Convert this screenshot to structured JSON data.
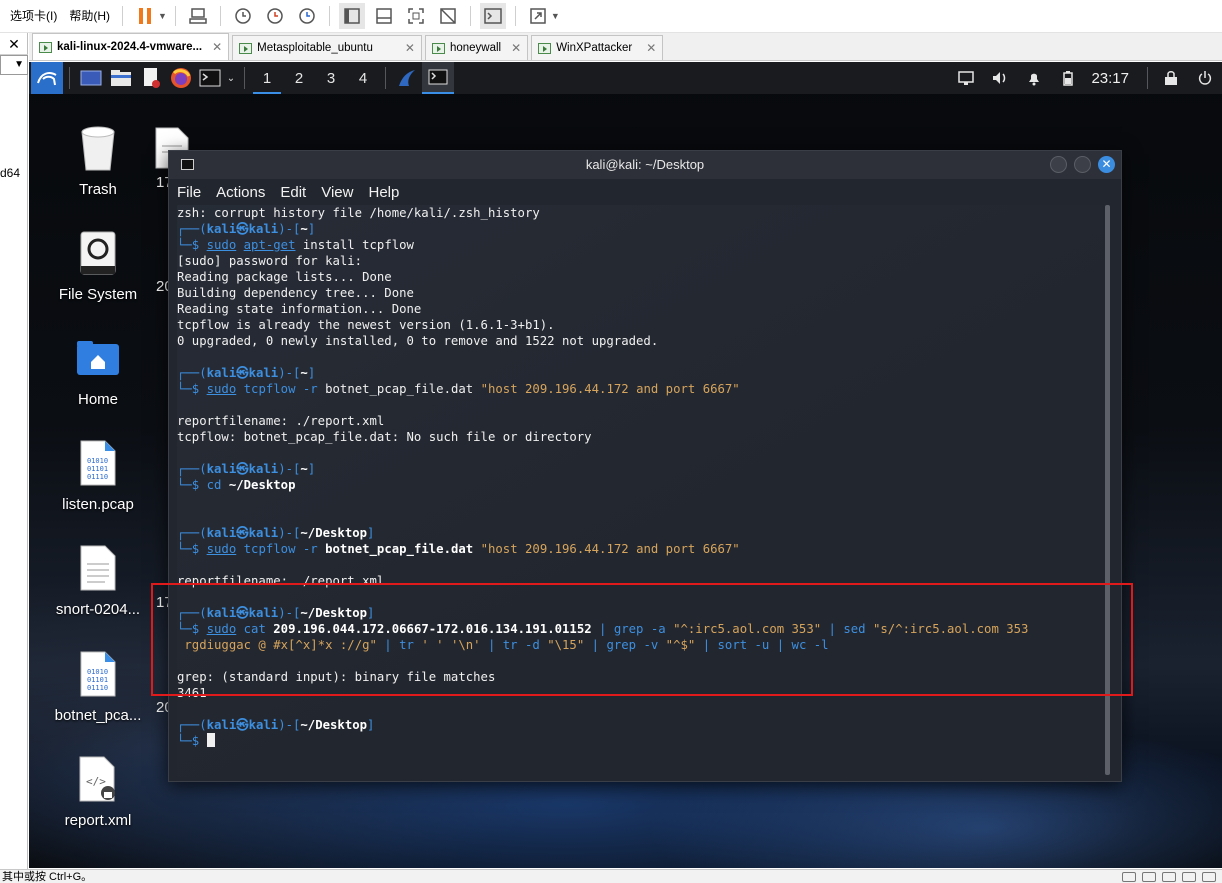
{
  "vmware": {
    "menu": [
      "选项卡(I)",
      "帮助(H)"
    ],
    "tabs": [
      {
        "label": "kali-linux-2024.4-vmware...",
        "close": "✕",
        "active": true
      },
      {
        "label": "Metasploitable_ubuntu",
        "close": "✕",
        "active": false
      },
      {
        "label": "honeywall",
        "close": "✕",
        "active": false
      },
      {
        "label": "WinXPattacker",
        "close": "✕",
        "active": false
      }
    ],
    "left_panel": {
      "close": "✕",
      "combo_arrow": "▼",
      "fragment": "d64"
    },
    "status_text": "其中或按 Ctrl+G。"
  },
  "kali": {
    "workspaces": [
      "1",
      "2",
      "3",
      "4"
    ],
    "active_workspace": "1",
    "clock": "23:17",
    "desktop_icons": [
      {
        "label": "Trash",
        "icon": "trash-icon"
      },
      {
        "label": "File System",
        "icon": "drive-icon"
      },
      {
        "label": "Home",
        "icon": "home-folder-icon"
      },
      {
        "label": "listen.pcap",
        "icon": "binary-file-icon"
      },
      {
        "label": "snort-0204...",
        "icon": "text-file-icon"
      },
      {
        "label": "botnet_pca...",
        "icon": "binary-file-icon"
      },
      {
        "label": "report.xml",
        "icon": "xml-file-icon"
      }
    ],
    "desktop_fragments": [
      "17",
      "20",
      "17",
      "20"
    ],
    "terminal": {
      "title": "kali@kali: ~/Desktop",
      "close_glyph": "✕",
      "menu": [
        "File",
        "Actions",
        "Edit",
        "View",
        "Help"
      ],
      "prompt": {
        "user": "kali",
        "at": "㉿",
        "host": "kali"
      },
      "lines": {
        "l1": "zsh: corrupt history file /home/kali/.zsh_history",
        "p1_dir": "~",
        "c1_sudo": "sudo",
        "c1_cmd": "apt-get",
        "c1_args": " install tcpflow",
        "l2": "[sudo] password for kali:",
        "l3": "Reading package lists... Done",
        "l4": "Building dependency tree... Done",
        "l5": "Reading state information... Done",
        "l6": "tcpflow is already the newest version (1.6.1-3+b1).",
        "l7": "0 upgraded, 0 newly installed, 0 to remove and 1522 not upgraded.",
        "p2_dir": "~",
        "c2_sudo": "sudo",
        "c2_cmd": "tcpflow",
        "c2_flag": " -r ",
        "c2_file": "botnet_pcap_file.dat",
        "c2_str": "\"host 209.196.44.172 and port 6667\"",
        "l8": "reportfilename: ./report.xml",
        "l9": "tcpflow: botnet_pcap_file.dat: No such file or directory",
        "p3_dir": "~",
        "c3_cmd": "cd",
        "c3_args": "~/Desktop",
        "p4_dir": "~/Desktop",
        "c4_sudo": "sudo",
        "c4_cmd": "tcpflow",
        "c4_flag": " -r ",
        "c4_file": "botnet_pcap_file.dat",
        "c4_str": "\"host 209.196.44.172 and port 6667\"",
        "l10": "reportfilename: ./report.xml",
        "p5_dir": "~/Desktop",
        "c5_sudo": "sudo",
        "c5_cmd": "cat",
        "c5_file": "209.196.044.172.06667-172.016.134.191.01152",
        "c5_part1": " | grep -a ",
        "c5_str1": "\"^:irc5.aol.com 353\"",
        "c5_part2": " | sed ",
        "c5_str2a": "\"s/^:irc5.aol.com 353",
        "c5_str2b": " rgdiuggac @ #x[^x]*x :/",
        "c5_str2c": "/g\"",
        "c5_part3": " | tr ",
        "c5_str3": "' ' '\\n'",
        "c5_part4": " | tr -d ",
        "c5_str4": "\"\\15\"",
        "c5_part5": " | grep -v ",
        "c5_str5": "\"^$\"",
        "c5_part6": " | sort -u | wc -l",
        "l11": "grep: (standard input): binary file matches",
        "l12": "3461",
        "p6_dir": "~/Desktop"
      }
    }
  },
  "colors": {
    "kali_blue": "#3d8fe0",
    "highlight_red": "#e01a1a",
    "string_orange": "#d6a45c"
  }
}
